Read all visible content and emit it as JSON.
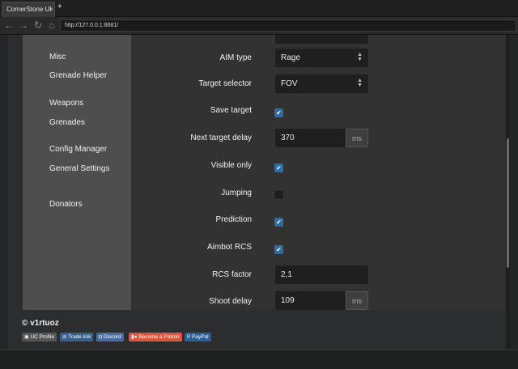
{
  "browser": {
    "tab_title": "CornerStone UI",
    "tab_close": "×",
    "new_tab": "+",
    "url": "http://127.0.0.1:8681/",
    "back_icon": "←",
    "forward_icon": "→",
    "reload_icon": "↻",
    "home_icon": "⌂"
  },
  "sidebar": {
    "items": [
      {
        "label": "Misc"
      },
      {
        "label": "Grenade Helper"
      },
      {
        "label": "Weapons"
      },
      {
        "label": "Grenades"
      },
      {
        "label": "Config Manager"
      },
      {
        "label": "General Settings"
      },
      {
        "label": "Donators"
      }
    ]
  },
  "settings": {
    "aim_type": {
      "label": "AIM type",
      "value": "Rage"
    },
    "target_selector": {
      "label": "Target selector",
      "value": "FOV"
    },
    "save_target": {
      "label": "Save target",
      "checked": true
    },
    "next_target_delay": {
      "label": "Next target delay",
      "value": "370",
      "unit": "ms"
    },
    "visible_only": {
      "label": "Visible only",
      "checked": true
    },
    "jumping": {
      "label": "Jumping",
      "checked": false
    },
    "prediction": {
      "label": "Prediction",
      "checked": true
    },
    "aimbot_rcs": {
      "label": "Aimbot RCS",
      "checked": true
    },
    "rcs_factor": {
      "label": "RCS factor",
      "value": "2,1"
    },
    "shoot_delay": {
      "label": "Shoot delay",
      "value": "109",
      "unit": "ms"
    }
  },
  "footer": {
    "credit": "© v1rtuoz",
    "badges": [
      {
        "label": "UC Profile",
        "icon": "uc-icon",
        "color": "#555555"
      },
      {
        "label": "Trade link",
        "icon": "steam-icon",
        "color": "#3b5f8a"
      },
      {
        "label": "Discord",
        "icon": "discord-icon",
        "color": "#4a6aa0"
      },
      {
        "label": "Become a Patron",
        "icon": "patreon-icon",
        "color": "#e0533d"
      },
      {
        "label": "PayPal",
        "icon": "paypal-icon",
        "color": "#2f5d96"
      }
    ]
  },
  "colors": {
    "accent": "#2f6da3",
    "sidebar_bg": "#4e4e4e",
    "panel_bg": "#323232"
  },
  "checkmark": "✔",
  "select_arrow": "▲▼"
}
